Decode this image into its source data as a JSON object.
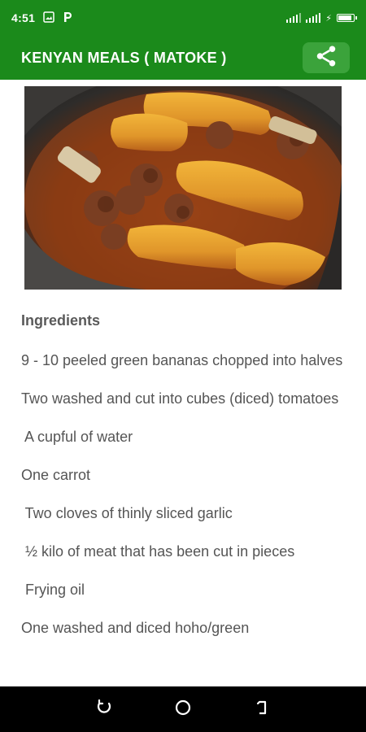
{
  "status_bar": {
    "time": "4:51",
    "icons": [
      "gallery-icon",
      "p-notification-icon",
      "signal-icon",
      "battery-icon"
    ]
  },
  "app_bar": {
    "title": "KENYAN MEALS ( MATOKE )",
    "share_icon": "share-icon",
    "color": "#1b8a1b"
  },
  "recipe": {
    "image": "matoke-dish-photo",
    "ingredients_heading": "Ingredients",
    "ingredients": [
      "9 - 10 peeled green bananas chopped into halves",
      "Two washed and cut into cubes (diced) tomatoes",
      " A cupful of water",
      "One carrot",
      " Two cloves of thinly sliced garlic",
      " ½ kilo of meat that has been cut in pieces",
      " Frying oil",
      "One washed and diced hoho/green"
    ]
  },
  "nav_bar": {
    "buttons": [
      "recents-icon",
      "home-icon",
      "back-icon"
    ]
  }
}
